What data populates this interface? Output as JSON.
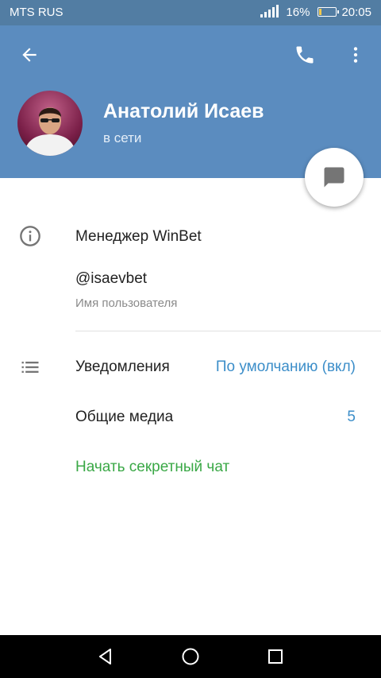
{
  "status_bar": {
    "carrier": "MTS RUS",
    "battery": "16%",
    "battery_level": 0.16,
    "time": "20:05"
  },
  "header": {
    "back_icon": "arrow-left-icon",
    "call_icon": "phone-icon",
    "more_icon": "more-vertical-icon",
    "name": "Анатолий Исаев",
    "status": "в сети",
    "fab_icon": "message-bubble-icon"
  },
  "info": {
    "icon": "info-icon",
    "bio": "Менеджер WinBet",
    "username": "@isaevbet",
    "username_label": "Имя пользователя"
  },
  "settings": {
    "icon": "list-icon",
    "notifications_label": "Уведомления",
    "notifications_value": "По умолчанию (вкл)",
    "shared_media_label": "Общие медиа",
    "shared_media_count": "5",
    "secret_chat_label": "Начать секретный чат"
  },
  "colors": {
    "header": "#5b8cbf",
    "statusbar": "#527da3",
    "accent_blue": "#3c8ec9",
    "accent_green": "#3aa846"
  },
  "navbar": {
    "back_icon": "nav-back-icon",
    "home_icon": "nav-home-icon",
    "recents_icon": "nav-recents-icon"
  }
}
